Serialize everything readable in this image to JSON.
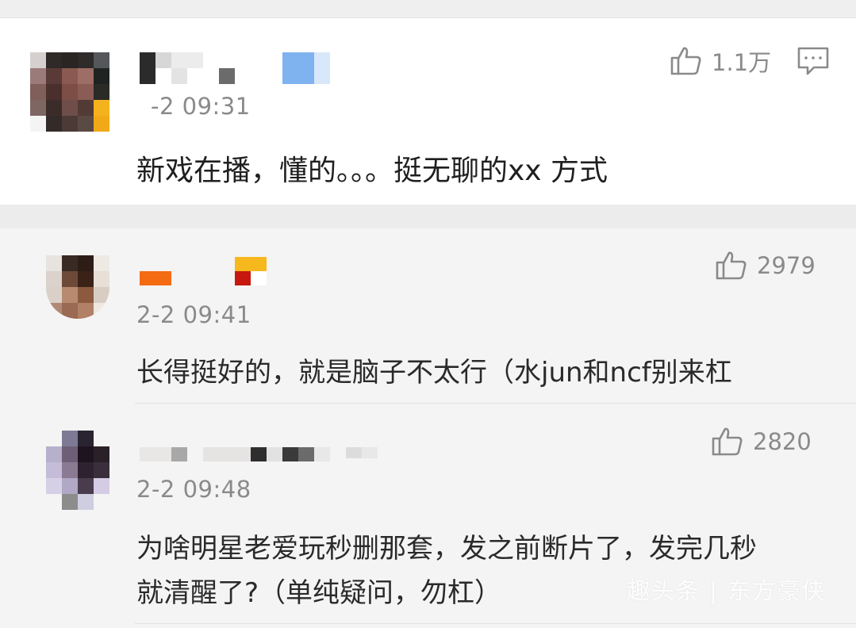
{
  "main_comment": {
    "time": "-2 09:31",
    "text": "新戏在播，懂的。。。挺无聊的xx 方式",
    "likes": "1.1万",
    "icons": {
      "like": "thumbs-up-icon",
      "reply": "comment-icon"
    }
  },
  "replies": [
    {
      "time": "2-2 09:41",
      "text": "长得挺好的，就是脑子不太行（水jun和ncf别来杠",
      "likes": "2979"
    },
    {
      "time": "2-2 09:48",
      "text_line1": "为啥明星老爱玩秒删那套，发之前断片了，发完几秒",
      "text_line2": "就清醒了?（单纯疑问，勿杠）",
      "likes": "2820"
    }
  ],
  "watermark": "趣头条 | 东方豪侠",
  "colors": {
    "muted_text": "#8a8a8a",
    "body_text": "#1f1f1f",
    "background": "#f4f4f4"
  }
}
